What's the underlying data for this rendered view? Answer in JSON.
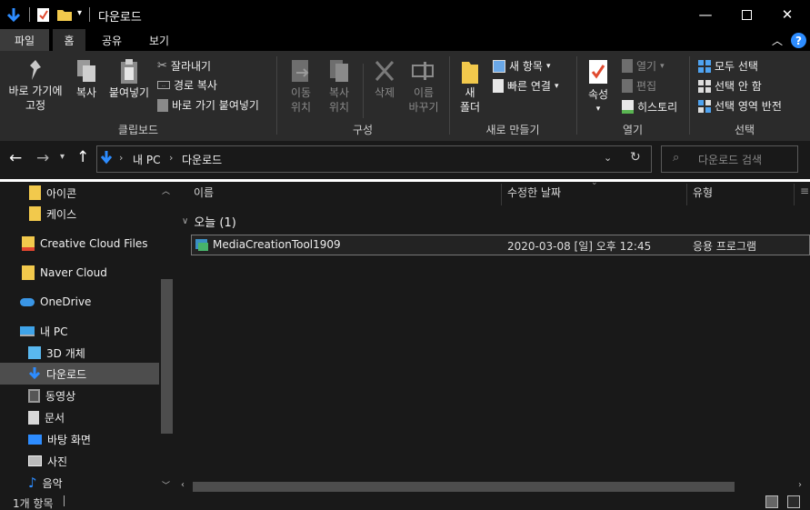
{
  "window": {
    "title": "다운로드",
    "minimize_icon": "minimize-icon",
    "maximize_icon": "maximize-icon",
    "close_icon": "close-icon"
  },
  "tabs": [
    {
      "label": "파일"
    },
    {
      "label": "홈"
    },
    {
      "label": "공유"
    },
    {
      "label": "보기"
    }
  ],
  "ribbon": {
    "clipboard": {
      "group_label": "클립보드",
      "pin_label_1": "바로 가기에",
      "pin_label_2": "고정",
      "copy_label": "복사",
      "paste_label": "붙여넣기",
      "cut_label": "잘라내기",
      "copy_path_label": "경로 복사",
      "paste_shortcut_label": "바로 가기 붙여넣기"
    },
    "organize": {
      "group_label": "구성",
      "move_label_1": "이동",
      "move_label_2": "위치",
      "copyto_label_1": "복사",
      "copyto_label_2": "위치",
      "delete_label": "삭제",
      "rename_label_1": "이름",
      "rename_label_2": "바꾸기"
    },
    "new": {
      "group_label": "새로 만들기",
      "new_folder_label_1": "새",
      "new_folder_label_2": "폴더",
      "new_item_label": "새 항목",
      "easy_access_label": "빠른 연결"
    },
    "open": {
      "group_label": "열기",
      "properties_label": "속성",
      "open_label": "열기",
      "edit_label": "편집",
      "history_label": "히스토리"
    },
    "select": {
      "group_label": "선택",
      "select_all_label": "모두 선택",
      "select_none_label": "선택 안 함",
      "invert_label": "선택 영역 반전"
    }
  },
  "address": {
    "crumbs": [
      "내 PC",
      "다운로드"
    ],
    "search_placeholder": "다운로드 검색"
  },
  "nav": {
    "items": [
      {
        "label": "아이콘",
        "icon": "folder-icon"
      },
      {
        "label": "케이스",
        "icon": "folder-icon"
      },
      {
        "label": "Creative Cloud Files",
        "icon": "creative-cloud-folder-icon"
      },
      {
        "label": "Naver Cloud",
        "icon": "folder-icon"
      },
      {
        "label": "OneDrive",
        "icon": "onedrive-icon"
      },
      {
        "label": "내 PC",
        "icon": "pc-icon"
      },
      {
        "label": "3D 개체",
        "icon": "3d-objects-icon"
      },
      {
        "label": "다운로드",
        "icon": "download-icon"
      },
      {
        "label": "동영상",
        "icon": "video-icon"
      },
      {
        "label": "문서",
        "icon": "document-icon"
      },
      {
        "label": "바탕 화면",
        "icon": "desktop-icon"
      },
      {
        "label": "사진",
        "icon": "pictures-icon"
      },
      {
        "label": "음악",
        "icon": "music-icon"
      }
    ]
  },
  "list": {
    "columns": [
      "이름",
      "수정한 날짜",
      "유형"
    ],
    "group_label": "오늘 (1)",
    "rows": [
      {
        "name": "MediaCreationTool1909",
        "modified": "2020-03-08 [일] 오후 12:45",
        "type": "응용 프로그램"
      }
    ]
  },
  "status": {
    "count": "1개 항목"
  },
  "colors": {
    "accent_blue": "#2d8cff",
    "folder_yellow": "#f2c94c",
    "ribbon_bg": "#2b2b2b",
    "window_bg": "#191919"
  }
}
